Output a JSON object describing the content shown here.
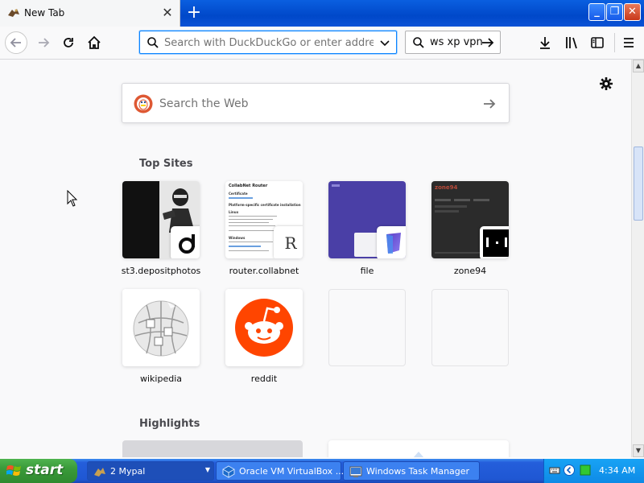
{
  "window": {
    "tab_title": "New Tab",
    "tab_close": "✕",
    "new_tab": "+",
    "minimize": "_",
    "restore": "❐",
    "close": "✕"
  },
  "toolbar": {
    "url_placeholder": "Search with DuckDuckGo or enter address",
    "search_value": "ws xp vpn"
  },
  "newtab": {
    "web_search_placeholder": "Search the Web",
    "top_sites_title": "Top Sites",
    "highlights_title": "Highlights",
    "top_sites": [
      {
        "label": "st3.depositphotos"
      },
      {
        "label": "router.collabnet"
      },
      {
        "label": "file"
      },
      {
        "label": "zone94"
      },
      {
        "label": "wikipedia"
      },
      {
        "label": "reddit"
      }
    ],
    "thumb_router": {
      "heading": "CollabNet Router",
      "sub1": "Certificate",
      "sub2": "Platform-specific certificate installation",
      "sub3": "Linux",
      "sub4": "Windows",
      "badge_letter": "R"
    },
    "thumb_zone": {
      "heading": "zone94"
    }
  },
  "taskbar": {
    "start_label": "start",
    "tasks": [
      {
        "label": "2 Mypal"
      },
      {
        "label": "Oracle VM VirtualBox ..."
      },
      {
        "label": "Windows Task Manager"
      }
    ],
    "clock": "4:34 AM"
  },
  "colors": {
    "accent": "#0a84ff",
    "reddit": "#ff4500",
    "ddg": "#de5833",
    "file_tile": "#4a3fa6",
    "taskbar": "#245edb",
    "start": "#3a9a3a"
  }
}
